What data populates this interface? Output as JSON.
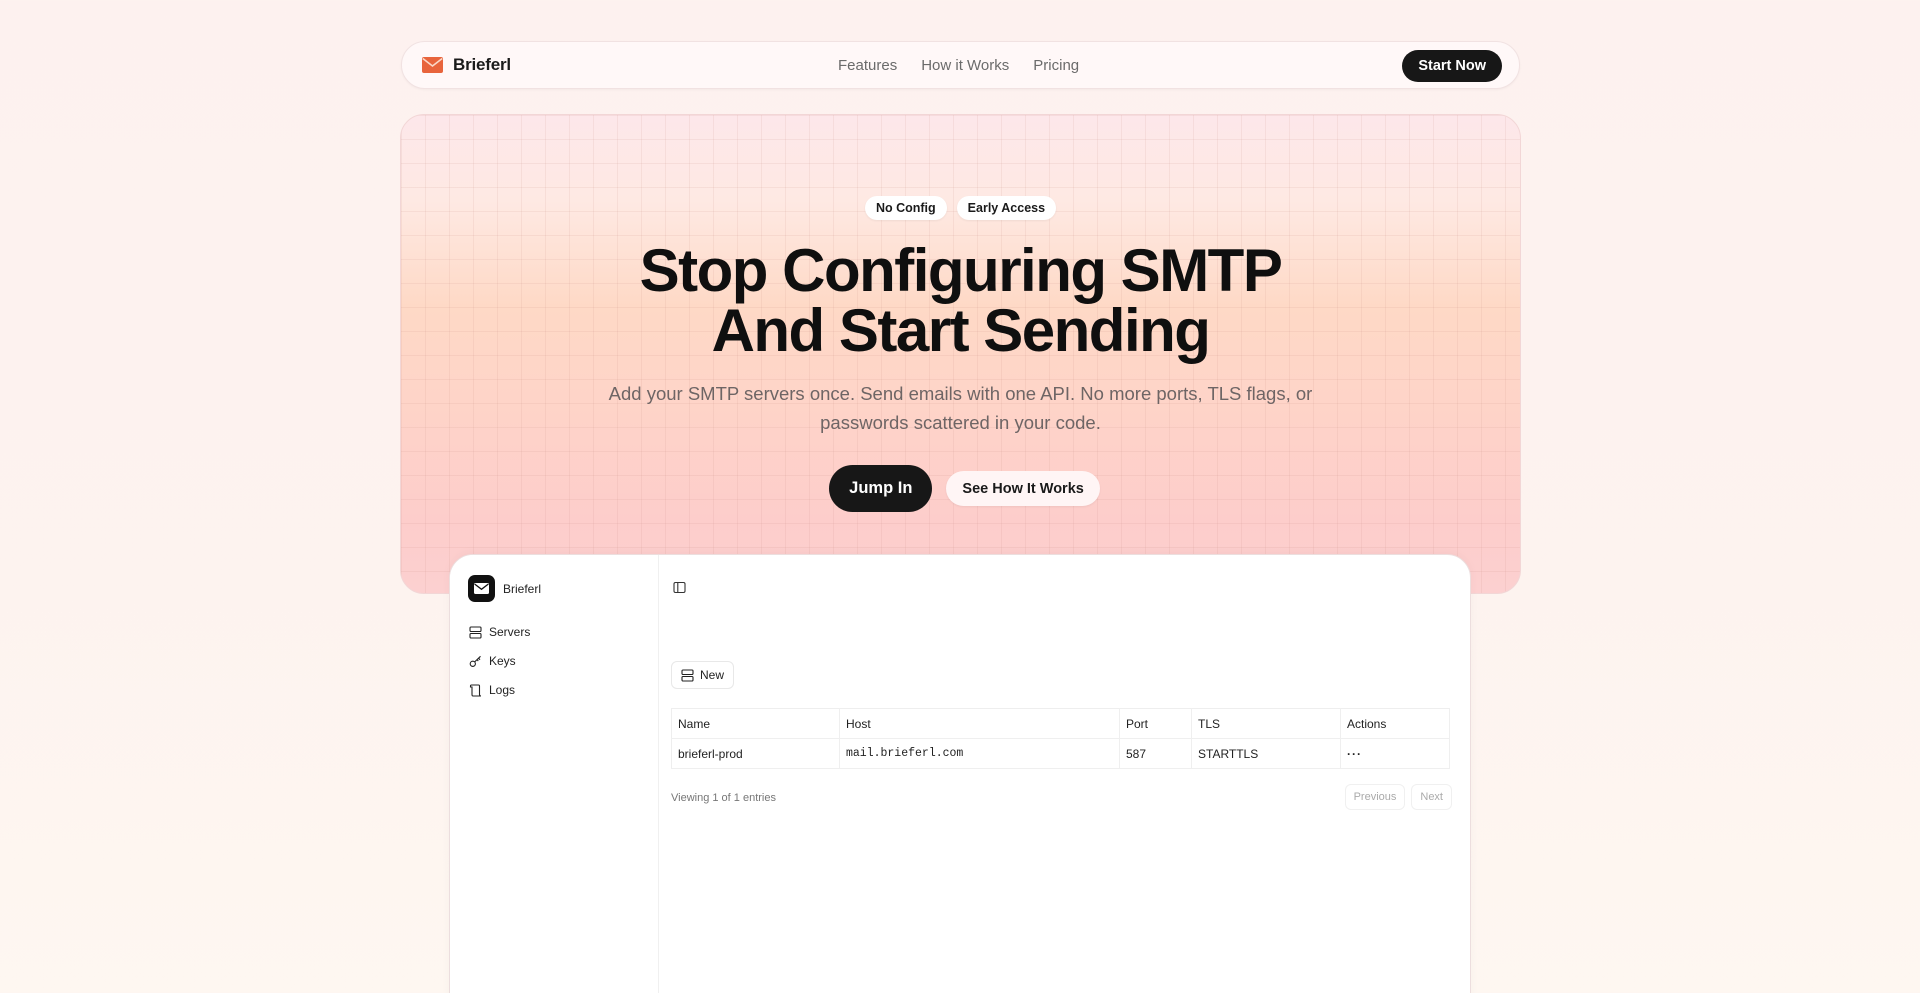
{
  "navbar": {
    "brand": "Brieferl",
    "links": [
      "Features",
      "How it Works",
      "Pricing"
    ],
    "cta": "Start Now"
  },
  "hero": {
    "badges": [
      "No Config",
      "Early Access"
    ],
    "title_line1": "Stop Configuring SMTP",
    "title_line2": "And Start Sending",
    "subtitle_line1": "Add your SMTP servers once. Send emails with one API. No more ports, TLS flags, or",
    "subtitle_line2": "passwords scattered in your code.",
    "primary_button": "Jump In",
    "secondary_button": "See How It Works"
  },
  "app": {
    "brand": "Brieferl",
    "sidebar": [
      {
        "label": "Servers",
        "icon": "server-icon"
      },
      {
        "label": "Keys",
        "icon": "key-icon"
      },
      {
        "label": "Logs",
        "icon": "logs-icon"
      }
    ],
    "new_button": "New",
    "table": {
      "headers": [
        "Name",
        "Host",
        "Port",
        "TLS",
        "Actions"
      ],
      "rows": [
        {
          "name": "brieferl-prod",
          "host": "mail.brieferl.com",
          "port": "587",
          "tls": "STARTTLS",
          "actions": "···"
        }
      ]
    },
    "footer": "Viewing 1 of 1 entries",
    "pagination": {
      "previous": "Previous",
      "next": "Next"
    }
  },
  "colors": {
    "accent": "#e8643c",
    "dark": "#171717"
  }
}
